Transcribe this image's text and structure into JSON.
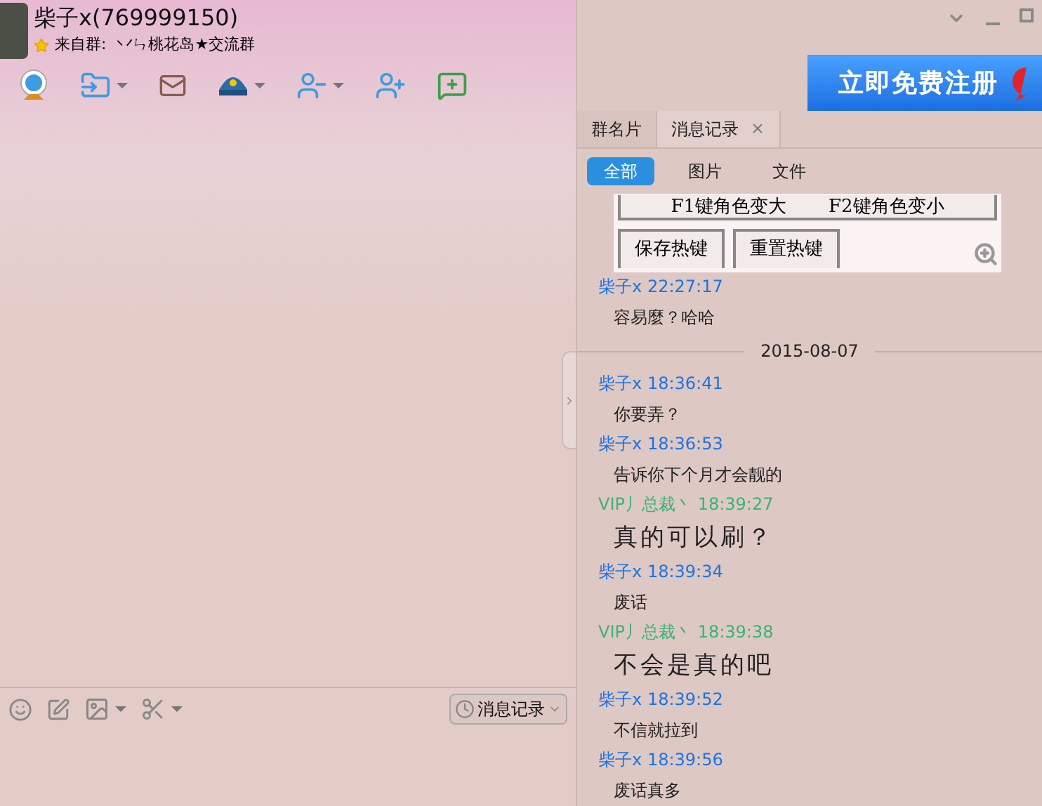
{
  "window": {
    "title": "柴子x(769999150)",
    "subtitle_prefix": "来自群:",
    "group": "丷ㄣ桃花岛★交流群"
  },
  "register_banner": {
    "label": "立即免费注册"
  },
  "tabs": [
    {
      "label": "群名片",
      "selected": false,
      "closable": false
    },
    {
      "label": "消息记录",
      "selected": true,
      "closable": true
    }
  ],
  "filters": [
    {
      "label": "全部",
      "selected": true
    },
    {
      "label": "图片",
      "selected": false
    },
    {
      "label": "文件",
      "selected": false
    }
  ],
  "history": [
    {
      "kind": "image",
      "buttons": [
        "F1键角色变大",
        "F2键角色变小"
      ],
      "buttons_2": [
        "保存热键",
        "重置热键"
      ]
    },
    {
      "kind": "message",
      "sender": "柴子x",
      "time": "22:27:17",
      "color": "#1a73e8",
      "text": "容易麼？哈哈"
    },
    {
      "kind": "date",
      "text": "2015-08-07"
    },
    {
      "kind": "message",
      "sender": "柴子x",
      "time": "18:36:41",
      "color": "#1a73e8",
      "text": "你要弄？"
    },
    {
      "kind": "message",
      "sender": "柴子x",
      "time": "18:36:53",
      "color": "#1a73e8",
      "text": "告诉你下个月才会靓的"
    },
    {
      "kind": "large_message",
      "sender": "VIP丿总裁丶",
      "time": "18:39:27",
      "color": "#3cb371",
      "text": "真的可以刷？"
    },
    {
      "kind": "message",
      "sender": "柴子x",
      "time": "18:39:34",
      "color": "#1a73e8",
      "text": "废话"
    },
    {
      "kind": "large_message",
      "sender": "VIP丿总裁丶",
      "time": "18:39:38",
      "color": "#3cb371",
      "text": "不会是真的吧"
    },
    {
      "kind": "message",
      "sender": "柴子x",
      "time": "18:39:52",
      "color": "#1a73e8",
      "text": "不信就拉到"
    },
    {
      "kind": "message",
      "sender": "柴子x",
      "time": "18:39:56",
      "color": "#1a73e8",
      "text": "废话真多"
    }
  ],
  "input_toolbar": {
    "history_button": "消息记录"
  }
}
